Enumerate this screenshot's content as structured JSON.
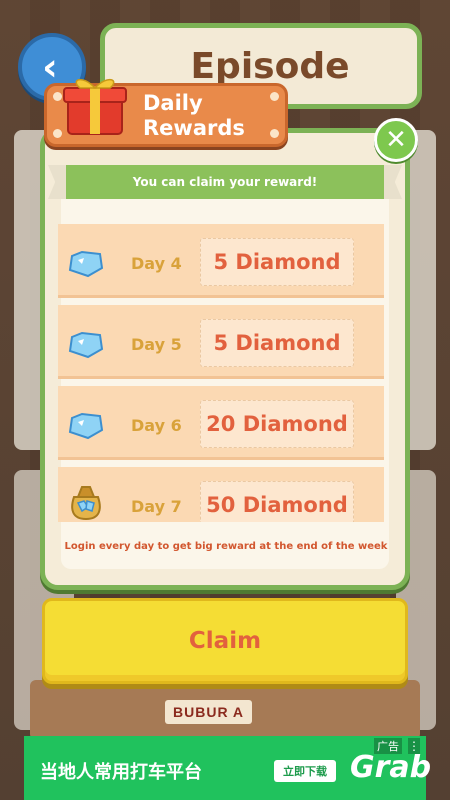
{
  "header": {
    "title": "Episode"
  },
  "popup": {
    "title_line1": "Daily",
    "title_line2": "Rewards",
    "banner": "You can claim your reward!",
    "rewards": [
      {
        "day": "Day 4",
        "amount": "5 Diamond",
        "icon": "diamond-icon"
      },
      {
        "day": "Day 5",
        "amount": "5 Diamond",
        "icon": "diamond-icon"
      },
      {
        "day": "Day 6",
        "amount": "20 Diamond",
        "icon": "diamond-icon"
      },
      {
        "day": "Day 7",
        "amount": "50 Diamond",
        "icon": "diamond-bag-icon"
      }
    ],
    "footer": "Login every day to get big reward at the end of the week",
    "claim_label": "Claim"
  },
  "background": {
    "sign_text": "BUBUR A"
  },
  "ad": {
    "tag": "广告",
    "text": "当地人常用打车平台",
    "button": "立即下载",
    "brand": "Grab"
  },
  "colors": {
    "panel_border": "#7cb255",
    "ribbon": "#e98a4a",
    "claim_button": "#f5dd34",
    "amount_text": "#e2613e",
    "ad_background": "#20c25d"
  }
}
